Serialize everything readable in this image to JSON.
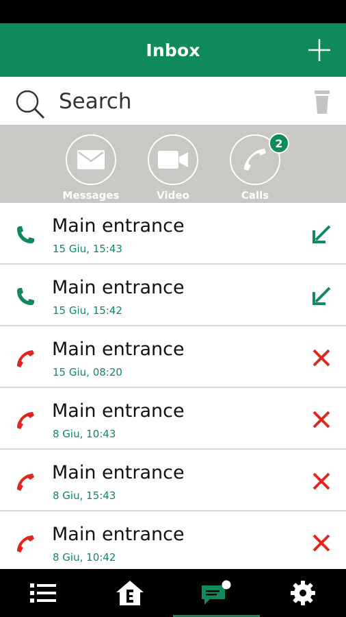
{
  "header": {
    "title": "Inbox",
    "add_icon": "plus-icon"
  },
  "search": {
    "placeholder": "Search",
    "value": ""
  },
  "filters": [
    {
      "label": "Messages",
      "icon": "envelope-icon"
    },
    {
      "label": "Video",
      "icon": "video-camera-icon"
    },
    {
      "label": "Calls",
      "icon": "phone-icon",
      "badge": "2"
    }
  ],
  "calls": [
    {
      "title": "Main entrance",
      "time": "15 Giu, 15:43",
      "status": "incoming"
    },
    {
      "title": "Main entrance",
      "time": "15 Giu, 15:42",
      "status": "incoming"
    },
    {
      "title": "Main entrance",
      "time": "15 Giu, 08:20",
      "status": "missed"
    },
    {
      "title": "Main entrance",
      "time": "8 Giu, 10:43",
      "status": "missed"
    },
    {
      "title": "Main entrance",
      "time": "8 Giu, 15:43",
      "status": "missed"
    },
    {
      "title": "Main entrance",
      "time": "8 Giu, 10:42",
      "status": "missed"
    }
  ],
  "nav": [
    {
      "id": "list",
      "icon": "list-icon"
    },
    {
      "id": "home",
      "icon": "home-icon"
    },
    {
      "id": "messages",
      "icon": "chat-bubble-icon",
      "active": true
    },
    {
      "id": "settings",
      "icon": "gear-icon"
    }
  ],
  "colors": {
    "brand": "#0f8a5b",
    "missed": "#e0261e",
    "strip": "#c8c8c4"
  }
}
